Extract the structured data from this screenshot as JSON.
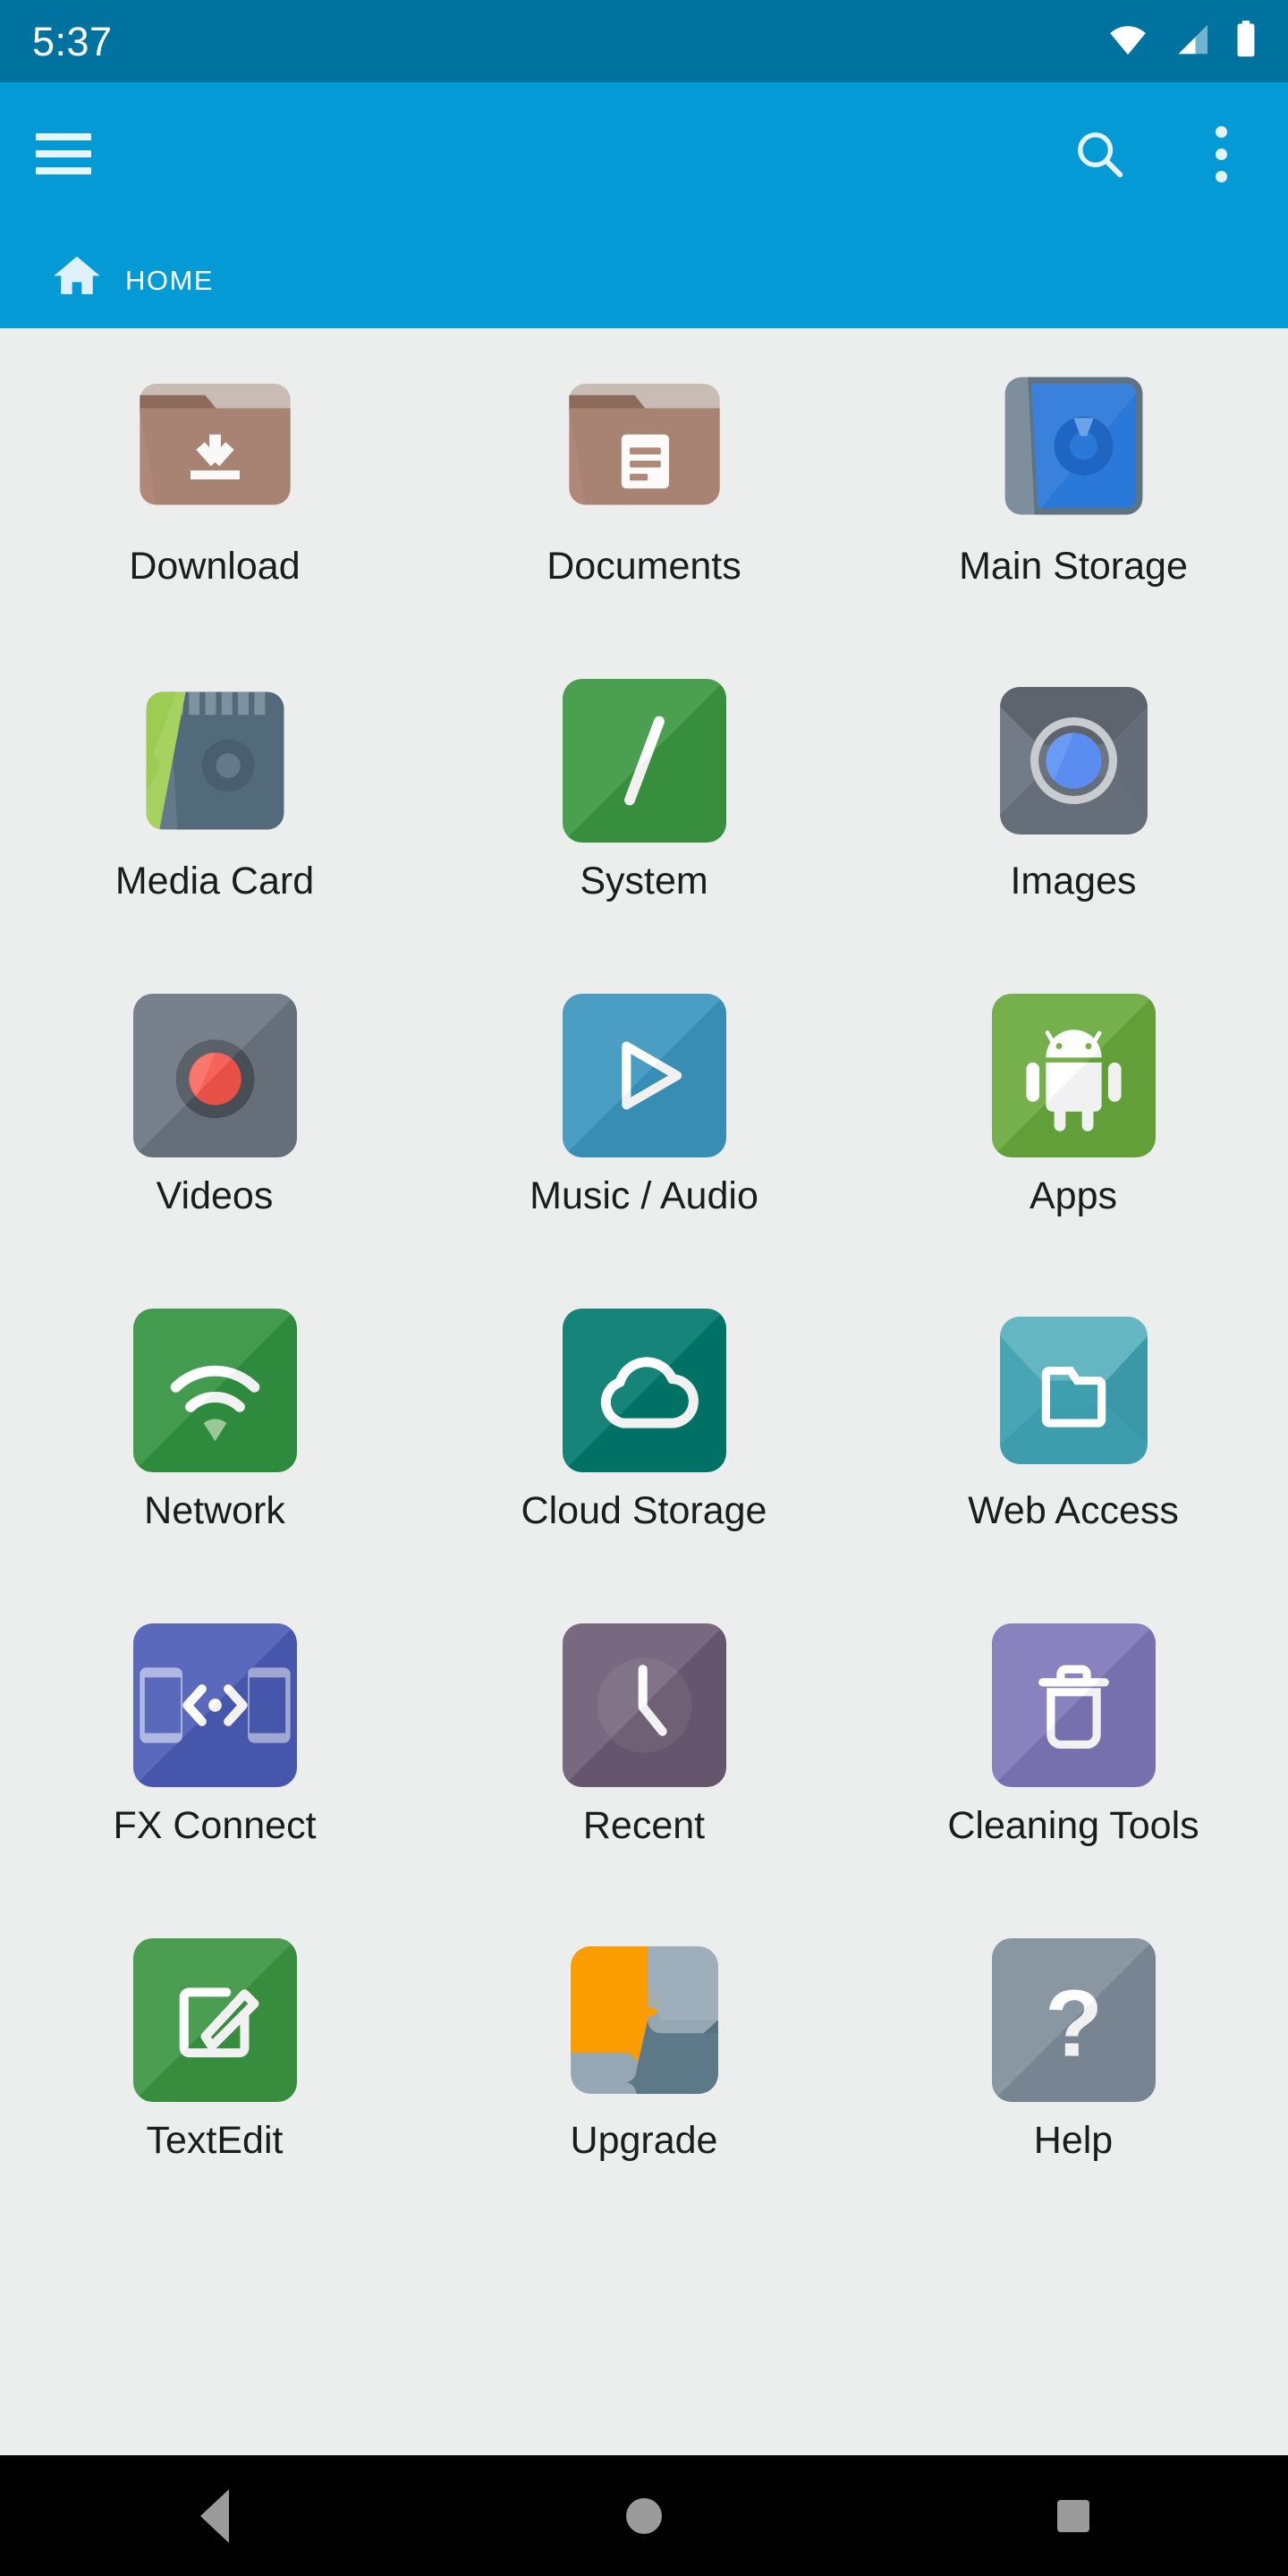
{
  "status_bar": {
    "time": "5:37",
    "icons": [
      "wifi-icon",
      "cellular-signal-icon",
      "battery-icon"
    ],
    "background": "#00729f"
  },
  "app_bar": {
    "background": "#039ad6",
    "menu_icon": "hamburger-menu-icon",
    "search_icon": "search-icon",
    "overflow_icon": "overflow-menu-icon",
    "breadcrumb": {
      "home_icon": "home-icon",
      "label": "Home"
    }
  },
  "grid": {
    "columns": 3,
    "items": [
      {
        "label": "Download",
        "icon": "download-folder-icon",
        "color": "#b08878"
      },
      {
        "label": "Documents",
        "icon": "documents-folder-icon",
        "color": "#b08878"
      },
      {
        "label": "Main Storage",
        "icon": "main-storage-icon",
        "color": "#2a78d8"
      },
      {
        "label": "Media Card",
        "icon": "media-card-icon",
        "color": "#64798a"
      },
      {
        "label": "System",
        "icon": "system-root-icon",
        "color": "#3a963f"
      },
      {
        "label": "Images",
        "icon": "images-camera-icon",
        "color": "#6d7580"
      },
      {
        "label": "Videos",
        "icon": "videos-record-icon",
        "color": "#6b7480"
      },
      {
        "label": "Music / Audio",
        "icon": "music-play-icon",
        "color": "#3a95bd"
      },
      {
        "label": "Apps",
        "icon": "apps-android-icon",
        "color": "#69a83b"
      },
      {
        "label": "Network",
        "icon": "network-wifi-icon",
        "color": "#31923f"
      },
      {
        "label": "Cloud Storage",
        "icon": "cloud-storage-icon",
        "color": "#00796b"
      },
      {
        "label": "Web Access",
        "icon": "web-access-folder-icon",
        "color": "#3e9fae"
      },
      {
        "label": "FX Connect",
        "icon": "fx-connect-icon",
        "color": "#4a5bb5"
      },
      {
        "label": "Recent",
        "icon": "recent-clock-icon",
        "color": "#6b5b74"
      },
      {
        "label": "Cleaning Tools",
        "icon": "cleaning-trash-icon",
        "color": "#7d77b8"
      },
      {
        "label": "TextEdit",
        "icon": "textedit-pencil-icon",
        "color": "#3a9442"
      },
      {
        "label": "Upgrade",
        "icon": "upgrade-puzzle-icon",
        "color": "#f99a00"
      },
      {
        "label": "Help",
        "icon": "help-question-icon",
        "color": "#7d8d99"
      }
    ]
  },
  "nav_bar": {
    "background": "#000000",
    "buttons": [
      {
        "name": "back-button",
        "icon": "back-triangle-icon"
      },
      {
        "name": "home-button",
        "icon": "home-circle-icon"
      },
      {
        "name": "recents-button",
        "icon": "recents-square-icon"
      }
    ]
  }
}
